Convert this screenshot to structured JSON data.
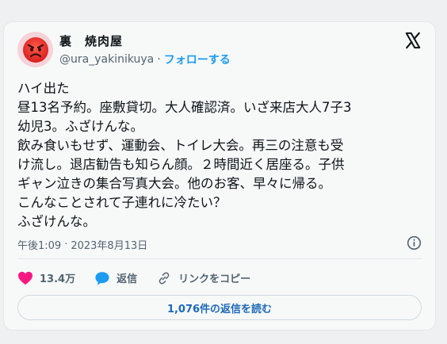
{
  "user": {
    "avatar_icon": "angry-face-icon",
    "display_name": "裏　焼肉屋",
    "handle": "@ura_yakinikuya",
    "separator": "·",
    "follow_label": "フォローする"
  },
  "platform_icon": "x-logo-icon",
  "tweet": {
    "text": "ハイ出た\n昼13名予約。座敷貸切。大人確認済。いざ来店大人7子3\n幼児3。ふざけんな。\n飲み食いもせず、運動会、トイレ大会。再三の注意も受\nけ流し。退店勧告も知らん顔。２時間近く居座る。子供\nギャン泣きの集合写真大会。他のお客、早々に帰る。\nこんなことされて子連れに冷たい？\nふざけんな。",
    "time": "午後1:09",
    "separator": "·",
    "date": "2023年8月13日"
  },
  "actions": {
    "like_count": "13.4万",
    "reply_label": "返信",
    "copy_link_label": "リンクをコピー"
  },
  "read_replies_label": "1,076件の返信を読む",
  "colors": {
    "accent": "#1d9bf0",
    "like": "#f91880",
    "reply": "#1d9bf0",
    "avatar_bg": "#f6d3d9"
  }
}
